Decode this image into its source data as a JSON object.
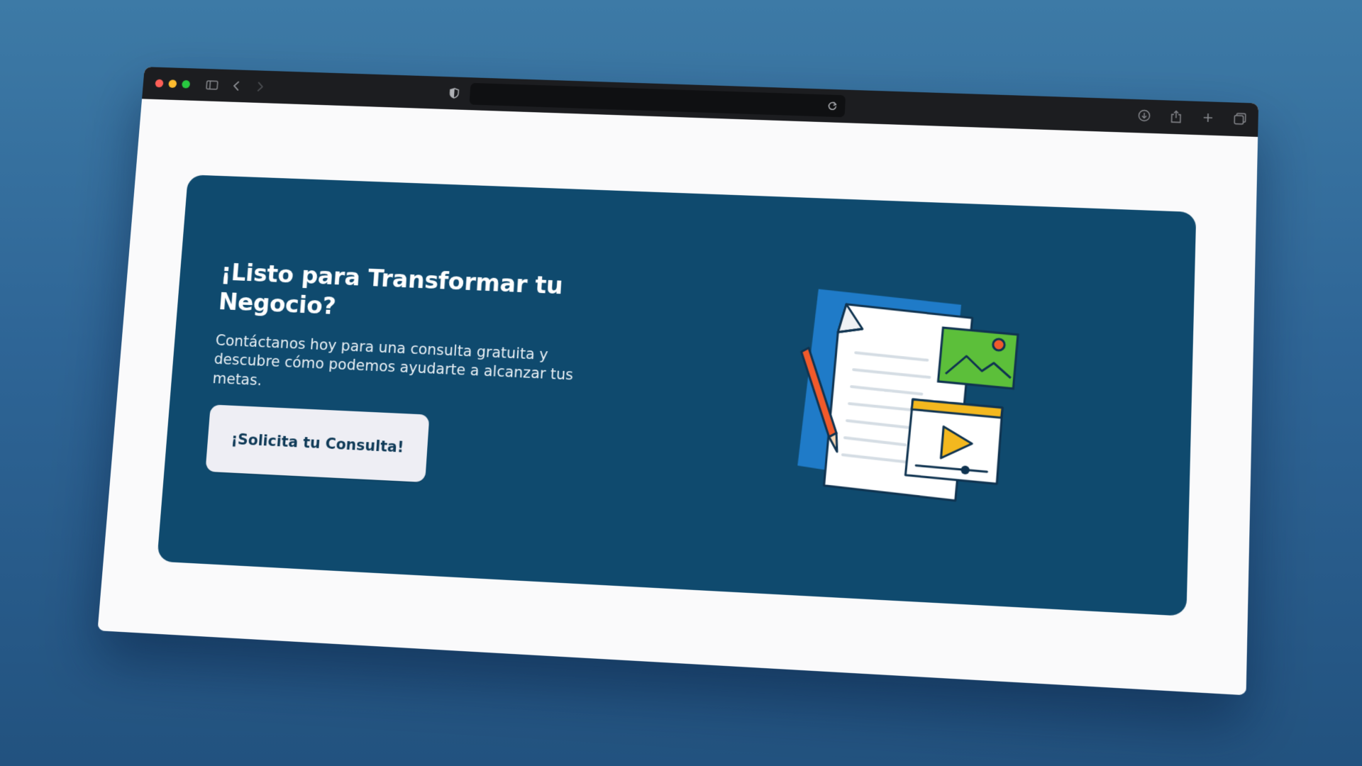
{
  "browser": {
    "address_value": "",
    "address_placeholder": ""
  },
  "cta": {
    "title": "¡Listo para Transformar tu Negocio?",
    "description": "Contáctanos hoy para una consulta gratuita y descubre cómo podemos ayudarte a alcanzar tus metas.",
    "button_label": "¡Solicita tu Consulta!"
  },
  "colors": {
    "background": "#2e6596",
    "card": "#0f4a6e",
    "button": "#eeeef4",
    "titlebar": "#1c1d20"
  },
  "icons": {
    "traffic_lights": [
      "close-icon",
      "minimize-icon",
      "zoom-icon"
    ],
    "toolbar_left": [
      "sidebar-icon",
      "back-icon",
      "forward-icon"
    ],
    "toolbar_right": [
      "download-icon",
      "share-icon",
      "new-tab-icon",
      "tabs-overview-icon"
    ],
    "illustration": "documents-media-illustration"
  }
}
